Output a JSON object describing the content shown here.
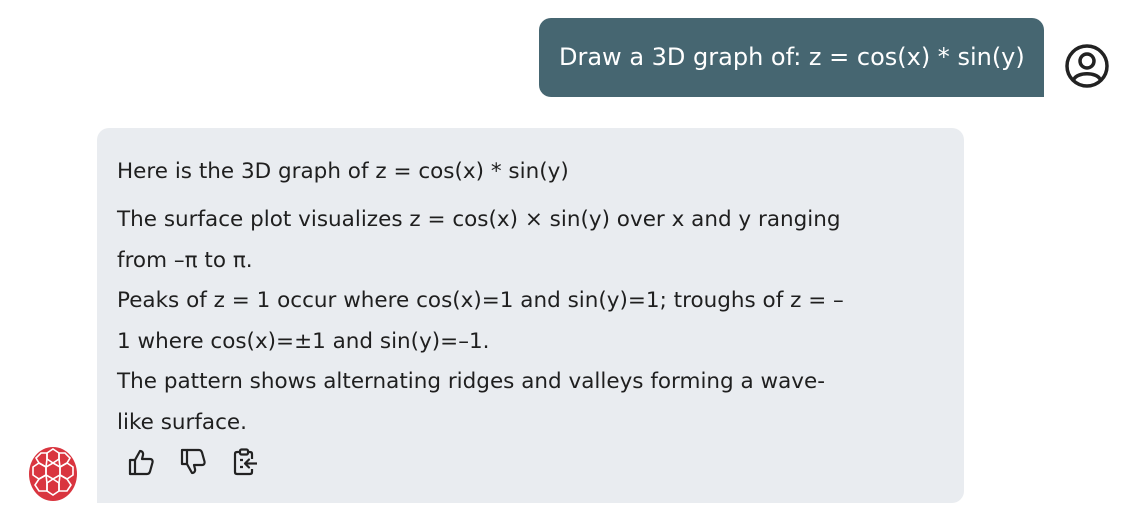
{
  "conversation": {
    "user_message": "Draw a 3D graph of: z = cos(x) * sin(y)",
    "assistant": {
      "heading": "Here is the 3D graph of z = cos(x) * sin(y)",
      "paragraph_1": "The surface plot visualizes z = cos(x) × sin(y) over x and y ranging\nfrom –π to π.",
      "paragraph_2": "Peaks of z = 1 occur where cos(x)=1 and sin(y)=1; troughs of z = –\n1 where cos(x)=±1 and sin(y)=–1.",
      "paragraph_3": "The pattern shows alternating ridges and valleys forming a wave-\nlike surface."
    }
  },
  "icons": {
    "user_avatar": "user-circle-icon",
    "bot_avatar": "turtle-shell-logo",
    "like": "thumbs-up-icon",
    "dislike": "thumbs-down-icon",
    "copy": "clipboard-copy-icon"
  },
  "colors": {
    "user_bubble": "#466671",
    "assistant_bubble": "#e9ecf0",
    "bot_logo": "#d9353f",
    "text": "#1f1f1f"
  }
}
